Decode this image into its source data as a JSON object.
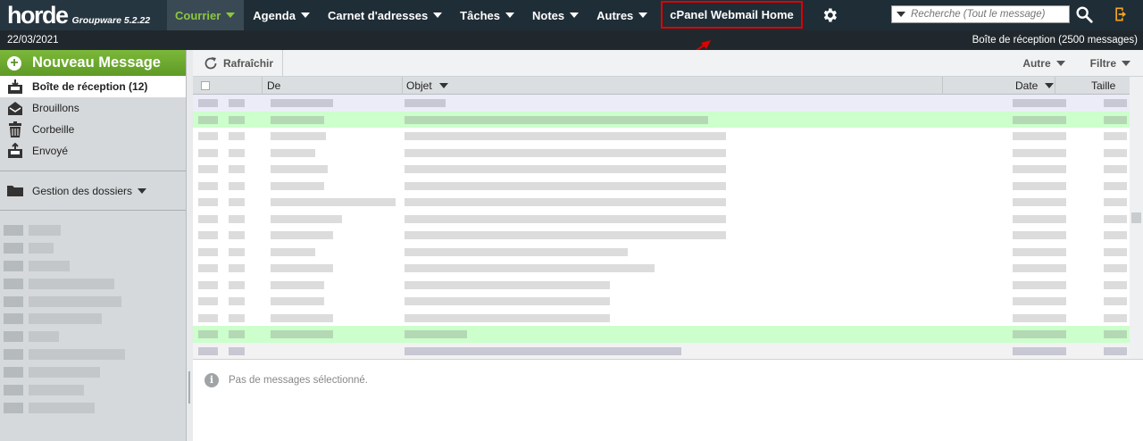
{
  "logo": {
    "word": "horde",
    "sub": "Groupware 5.2.22"
  },
  "nav": [
    {
      "label": "Courrier",
      "caret": true,
      "active": true
    },
    {
      "label": "Agenda",
      "caret": true
    },
    {
      "label": "Carnet d'adresses",
      "caret": true
    },
    {
      "label": "Tâches",
      "caret": true
    },
    {
      "label": "Notes",
      "caret": true
    },
    {
      "label": "Autres",
      "caret": true
    }
  ],
  "cpanel_link": "cPanel Webmail Home",
  "search": {
    "placeholder": "Recherche (Tout le message)"
  },
  "status": {
    "date": "22/03/2021",
    "mailbox_summary": "Boîte de réception (2500 messages)"
  },
  "sidebar": {
    "new_message": "Nouveau Message",
    "folders": [
      {
        "label": "Boîte de réception (12)",
        "icon": "inbox-icon",
        "selected": true
      },
      {
        "label": "Brouillons",
        "icon": "drafts-icon"
      },
      {
        "label": "Corbeille",
        "icon": "trash-icon"
      },
      {
        "label": "Envoyé",
        "icon": "sent-icon"
      }
    ],
    "manage_folders": "Gestion des dossiers"
  },
  "toolbar": {
    "refresh": "Rafraîchir",
    "other": "Autre",
    "filter": "Filtre"
  },
  "columns": {
    "from": "De",
    "subject": "Objet",
    "date": "Date",
    "size": "Taille"
  },
  "preview": {
    "empty": "Pas de messages sélectionné."
  },
  "colors": {
    "accent_green": "#8cc63f",
    "topbar": "#1f2d36",
    "highlight_red": "#e00000",
    "unread_row": "#ccffcc"
  }
}
